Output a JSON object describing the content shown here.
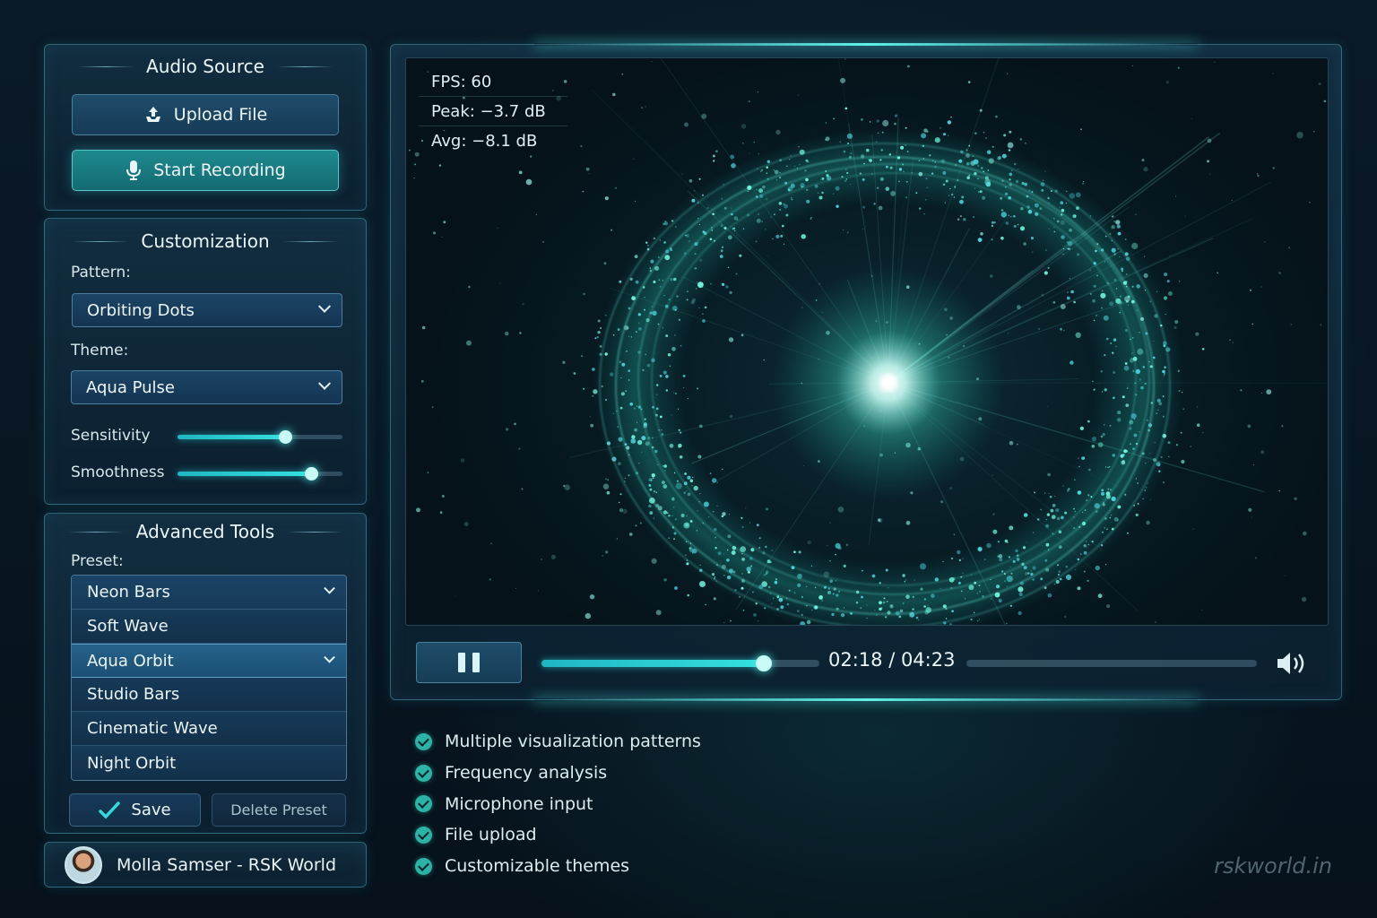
{
  "audio_source": {
    "title": "Audio Source",
    "upload_label": "Upload File",
    "record_label": "Start Recording"
  },
  "customization": {
    "title": "Customization",
    "pattern_label": "Pattern:",
    "pattern_value": "Orbiting Dots",
    "theme_label": "Theme:",
    "theme_value": "Aqua Pulse",
    "sensitivity_label": "Sensitivity",
    "sensitivity_level": 0.65,
    "smoothness_label": "Smoothness",
    "smoothness_level": 0.81
  },
  "advanced_tools": {
    "title": "Advanced Tools",
    "preset_label": "Preset:",
    "preset_options": [
      {
        "label": "Neon Bars",
        "state": "current"
      },
      {
        "label": "Soft Wave",
        "state": ""
      },
      {
        "label": "Aqua Orbit",
        "state": "selected"
      },
      {
        "label": "Studio Bars",
        "state": ""
      },
      {
        "label": "Cinematic Wave",
        "state": ""
      },
      {
        "label": "Night Orbit",
        "state": ""
      }
    ],
    "save_label": "Save",
    "delete_label": "Delete Preset"
  },
  "user": {
    "name": "Molla Samser - RSK World"
  },
  "stats": {
    "fps": "FPS:  60",
    "peak": "Peak: −3.7 dB",
    "avg": "Avg: −8.1 dB"
  },
  "player": {
    "time": "02:18 / 04:23",
    "progress": 0.8,
    "volume": 1.0
  },
  "features": [
    "Multiple visualization patterns",
    "Frequency analysis",
    "Microphone input",
    "File upload",
    "Customizable themes"
  ],
  "brand": "rskworld.in",
  "colors": {
    "accent": "#35e0df",
    "record_button": "#1e8a8e",
    "check": "#2bb3a6"
  }
}
